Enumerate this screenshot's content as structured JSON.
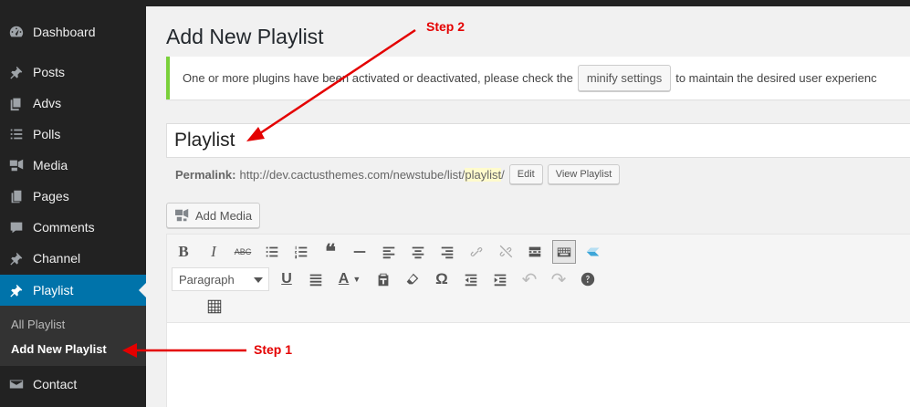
{
  "sidebar": {
    "items": [
      {
        "label": "Dashboard",
        "icon": "dashboard-icon"
      },
      {
        "label": "Posts",
        "icon": "pin-icon"
      },
      {
        "label": "Advs",
        "icon": "copy-icon"
      },
      {
        "label": "Polls",
        "icon": "list-icon"
      },
      {
        "label": "Media",
        "icon": "media-icon"
      },
      {
        "label": "Pages",
        "icon": "pages-icon"
      },
      {
        "label": "Comments",
        "icon": "comment-icon"
      },
      {
        "label": "Channel",
        "icon": "pin-icon"
      },
      {
        "label": "Playlist",
        "icon": "pin-icon",
        "active": true
      },
      {
        "label": "Contact",
        "icon": "mail-icon"
      }
    ],
    "submenu": [
      {
        "label": "All Playlist"
      },
      {
        "label": "Add New Playlist",
        "current": true
      }
    ]
  },
  "page": {
    "title": "Add New Playlist"
  },
  "notice": {
    "text_before": "One or more plugins have been activated or deactivated, please check the",
    "button_label": "minify settings",
    "text_after": "to maintain the desired user experienc"
  },
  "post": {
    "title_value": "Playlist",
    "permalink_label": "Permalink:",
    "permalink_base": "http://dev.cactusthemes.com/newstube/list/",
    "permalink_slug": "playlist",
    "permalink_trailing": "/",
    "edit_label": "Edit",
    "view_label": "View Playlist"
  },
  "editor": {
    "add_media_label": "Add Media",
    "format_value": "Paragraph",
    "toolbar_row1": [
      "bold",
      "italic",
      "strikethrough",
      "bulleted-list",
      "numbered-list",
      "blockquote",
      "horizontal-rule",
      "align-left",
      "align-center",
      "align-right",
      "link",
      "unlink",
      "read-more",
      "toolbar-toggle",
      "shortcode"
    ],
    "toolbar_row2": [
      "format-select",
      "underline",
      "justify",
      "text-color",
      "paste-as-text",
      "clear-formatting",
      "special-character",
      "outdent",
      "indent",
      "undo",
      "redo",
      "help"
    ],
    "toolbar_row3": [
      "table"
    ]
  },
  "annotations": {
    "step1": "Step 1",
    "step2": "Step 2"
  },
  "colors": {
    "sidebar_bg": "#222222",
    "active_bg": "#0073aa",
    "notice_border": "#7ad03a",
    "annotation": "#e40000"
  }
}
